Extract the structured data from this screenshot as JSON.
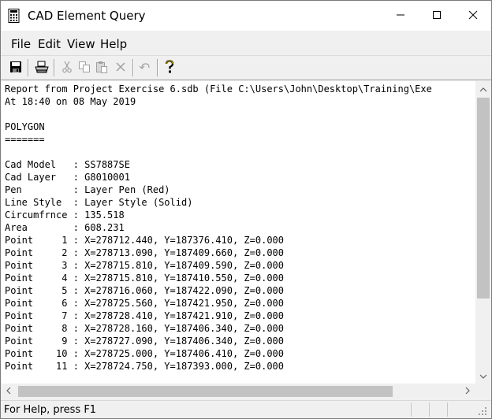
{
  "window": {
    "title": "CAD Element Query",
    "icons": {
      "app": "calculator-icon",
      "minimize": "minimize-icon",
      "maximize": "maximize-icon",
      "close": "close-icon"
    }
  },
  "menu": {
    "file": "File",
    "edit": "Edit",
    "view": "View",
    "help": "Help"
  },
  "toolbar": {
    "icons": [
      "save-icon",
      "print-icon",
      "cut-icon",
      "copy-icon",
      "paste-icon",
      "delete-icon",
      "undo-icon",
      "help-icon"
    ]
  },
  "report": {
    "lines": [
      "Report from Project Exercise 6.sdb (File C:\\Users\\John\\Desktop\\Training\\Exe",
      "At 18:40 on 08 May 2019",
      "",
      "POLYGON",
      "=======",
      "",
      "Cad Model   : SS7887SE",
      "Cad Layer   : G8010001",
      "Pen         : Layer Pen (Red)",
      "Line Style  : Layer Style (Solid)",
      "Circumfrnce : 135.518",
      "Area        : 608.231",
      "Point     1 : X=278712.440, Y=187376.410, Z=0.000",
      "Point     2 : X=278713.090, Y=187409.660, Z=0.000",
      "Point     3 : X=278715.810, Y=187409.590, Z=0.000",
      "Point     4 : X=278715.810, Y=187410.550, Z=0.000",
      "Point     5 : X=278716.060, Y=187422.090, Z=0.000",
      "Point     6 : X=278725.560, Y=187421.950, Z=0.000",
      "Point     7 : X=278728.410, Y=187421.910, Z=0.000",
      "Point     8 : X=278728.160, Y=187406.340, Z=0.000",
      "Point     9 : X=278727.090, Y=187406.340, Z=0.000",
      "Point    10 : X=278725.000, Y=187406.410, Z=0.000",
      "Point    11 : X=278724.750, Y=187393.000, Z=0.000"
    ]
  },
  "status": {
    "text": "For Help, press F1"
  }
}
